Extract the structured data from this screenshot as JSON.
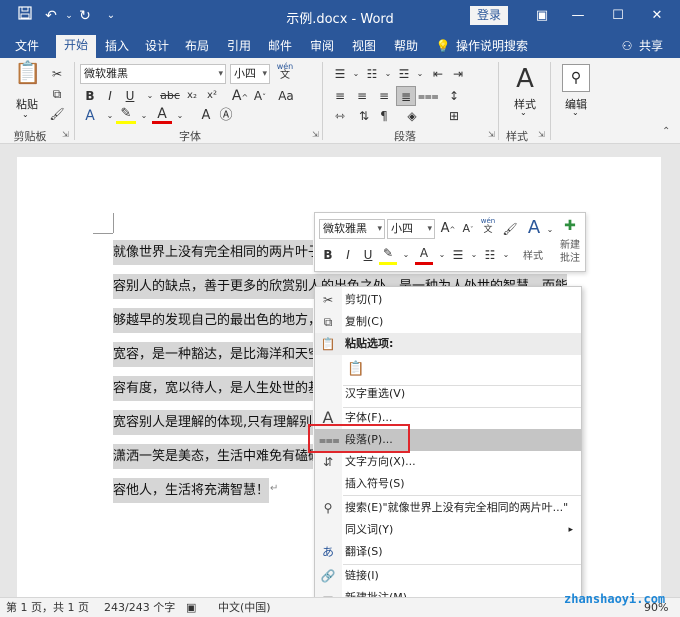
{
  "titlebar": {
    "title": "示例.docx - Word",
    "login": "登录",
    "save_icon": "save-icon",
    "undo_icon": "undo-icon",
    "redo_icon": "redo-icon"
  },
  "tabs": [
    "文件",
    "开始",
    "插入",
    "设计",
    "布局",
    "引用",
    "邮件",
    "审阅",
    "视图",
    "帮助"
  ],
  "tell_me": "操作说明搜索",
  "share": "共享",
  "ribbon": {
    "clipboard": {
      "paste": "粘贴",
      "label": "剪贴板"
    },
    "font": {
      "name": "微软雅黑",
      "size": "小四",
      "label": "字体",
      "pinyin": "wén",
      "pinyin_sub": "文"
    },
    "paragraph": {
      "label": "段落"
    },
    "styles": {
      "button": "样式",
      "label": "样式"
    },
    "editing": {
      "button": "编辑"
    }
  },
  "document": {
    "lines": [
      "就像世界上没有完全相同的两片叶子",
      "容别人的缺点，善于更多的欣赏别人的出色之处，是一种为人处世的智慧，而能",
      "够越早的发现自己的最出色的地方，",
      "宽容，是一种豁达，是比海洋和天空",
      "容有度，宽以待人，是人生处世的基",
      "宽容别人是理解的体现,只有理解别",
      "潇洒一笑是美态，生活中难免有磕磕",
      "容他人，生活将充满智慧！"
    ]
  },
  "mini_toolbar": {
    "font": "微软雅黑",
    "size": "小四",
    "styles": "样式",
    "new_comment_1": "新建",
    "new_comment_2": "批注",
    "pinyin": "wén",
    "pinyin_sub": "文"
  },
  "context_menu": {
    "items": [
      {
        "label": "剪切(T)",
        "icon": "scissors-icon"
      },
      {
        "label": "复制(C)",
        "icon": "copy-icon"
      },
      {
        "label": "粘贴选项:",
        "icon": "paste-icon"
      },
      {
        "label": "",
        "icon": "paste-keep-text-icon"
      },
      {
        "label": "汉字重选(V)",
        "icon": ""
      },
      {
        "label": "字体(F)...",
        "icon": "font-icon"
      },
      {
        "label": "段落(P)...",
        "icon": "paragraph-icon"
      },
      {
        "label": "文字方向(X)...",
        "icon": "text-direction-icon"
      },
      {
        "label": "插入符号(S)",
        "icon": ""
      },
      {
        "label": "搜索(E)\"就像世界上没有完全相同的两片叶...\"",
        "icon": "search-icon"
      },
      {
        "label": "同义词(Y)",
        "icon": ""
      },
      {
        "label": "翻译(S)",
        "icon": "translate-icon"
      },
      {
        "label": "链接(I)",
        "icon": "link-icon"
      },
      {
        "label": "新建批注(M)",
        "icon": "new-comment-icon"
      }
    ]
  },
  "status": {
    "page": "第 1 页，共 1 页",
    "words": "243/243 个字",
    "language": "中文(中国)",
    "zoom": "90%"
  },
  "watermark": "zhanshaoyi.com",
  "colors": {
    "accent": "#2b579a",
    "highlight": "#d6d6d6",
    "red_box": "#e0262b"
  }
}
